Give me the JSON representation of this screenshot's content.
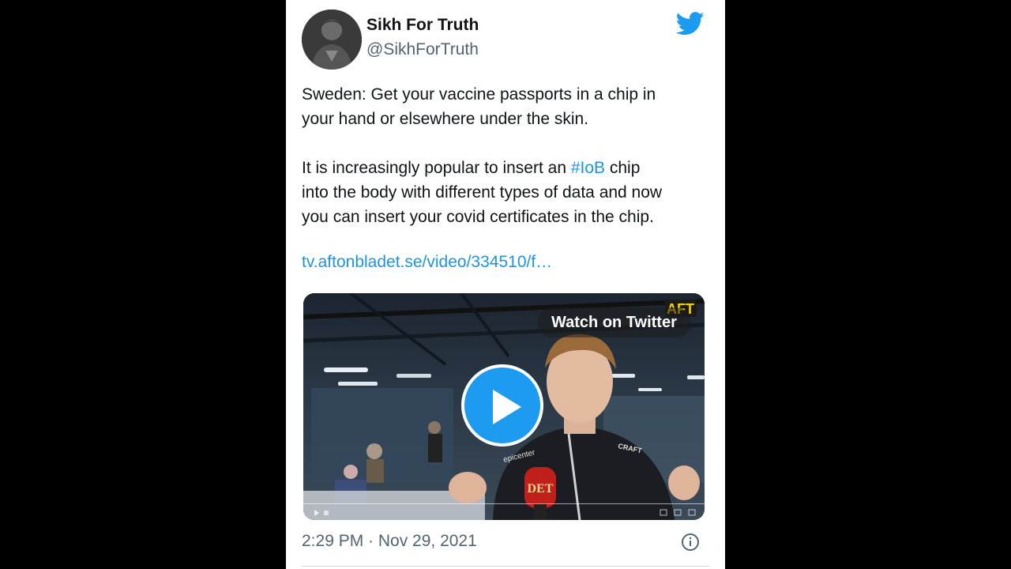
{
  "author": {
    "display_name": "Sikh For Truth",
    "handle": "@SikhForTruth"
  },
  "tweet": {
    "line1": "Sweden: Get your vaccine passports in a chip in",
    "line2": "your hand or elsewhere under the skin.",
    "line3_before": "It is increasingly popular to insert an ",
    "hashtag": "#IoB",
    "line3_after": " chip",
    "line4": "into the body with different types of data and now",
    "line5": "you can insert your covid certificates in the chip.",
    "url": "tv.aftonbladet.se/video/334510/f…"
  },
  "video": {
    "watch_label": "Watch on Twitter",
    "corner_logo_text": "AFT",
    "mic_text": "DET",
    "shirt_text_left": "epicenter",
    "shirt_text_right": "CRAFT"
  },
  "meta": {
    "timestamp": "2:29 PM · Nov 29, 2021"
  },
  "colors": {
    "brand": "#1d9bf0",
    "link": "#1b95e0",
    "text": "#0f1419",
    "muted": "#536471"
  },
  "icons": [
    "twitter-bird-icon",
    "play-icon",
    "info-icon"
  ]
}
